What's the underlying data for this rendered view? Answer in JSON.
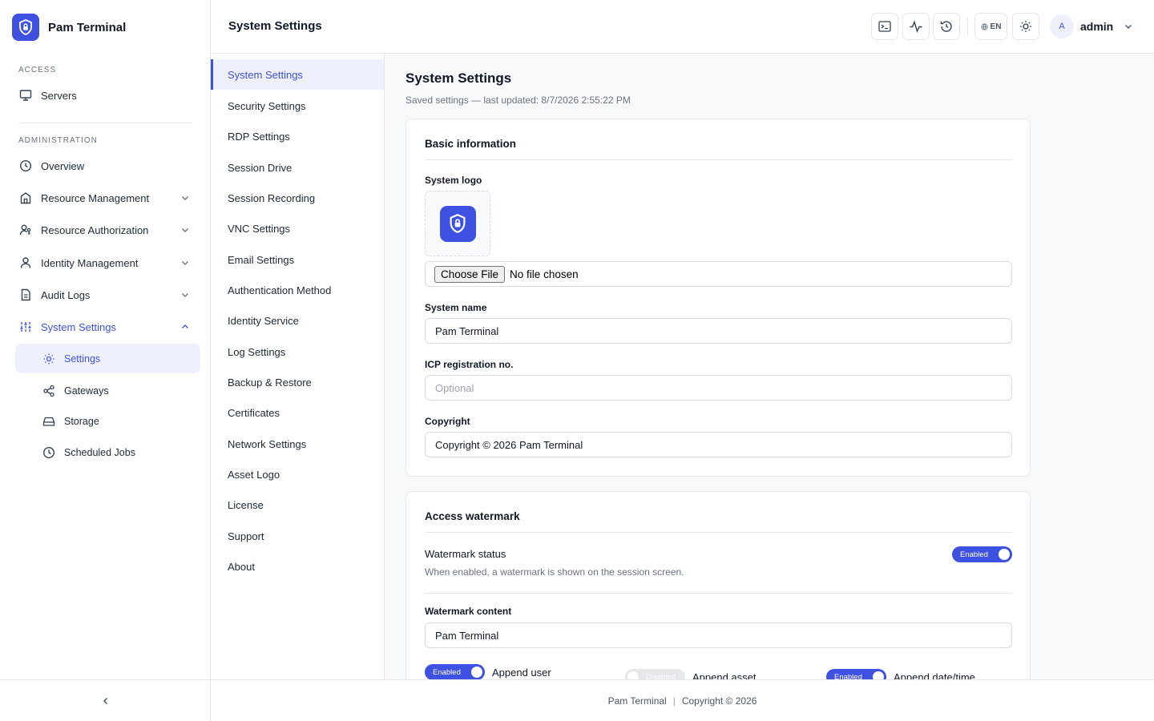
{
  "app": {
    "name": "Pam Terminal"
  },
  "sidebar": {
    "section_access": "ACCESS",
    "access_items": [
      {
        "label": "Servers",
        "icon": "monitor-icon"
      }
    ],
    "section_admin": "ADMINISTRATION",
    "admin_items": [
      {
        "label": "Overview",
        "icon": "clock-icon"
      },
      {
        "label": "Resource Management",
        "icon": "building-icon"
      },
      {
        "label": "Resource Authorization",
        "icon": "user-key-icon"
      },
      {
        "label": "Identity Management",
        "icon": "user-icon"
      },
      {
        "label": "Audit Logs",
        "icon": "document-icon"
      },
      {
        "label": "System Settings",
        "icon": "sliders-icon"
      }
    ],
    "system_sub_items": [
      {
        "label": "Settings",
        "icon": "sun-gear-icon"
      },
      {
        "label": "Gateways",
        "icon": "share-icon"
      },
      {
        "label": "Storage",
        "icon": "hard-drive-icon"
      },
      {
        "label": "Scheduled Jobs",
        "icon": "clock-icon"
      }
    ]
  },
  "header": {
    "title": "System Settings",
    "language": "EN",
    "user_initial": "A",
    "username": "admin"
  },
  "subnav": {
    "items": [
      "System Settings",
      "Security Settings",
      "RDP Settings",
      "Session Drive",
      "Session Recording",
      "VNC Settings",
      "Email Settings",
      "Authentication Method",
      "Identity Service",
      "Log Settings",
      "Backup & Restore",
      "Certificates",
      "Network Settings",
      "Asset Logo",
      "License",
      "Support",
      "About"
    ]
  },
  "main": {
    "title": "System Settings",
    "subtitle": "Saved settings — last updated: 8/7/2026 2:55:22 PM",
    "basic": {
      "title": "Basic information",
      "logo_label": "System logo",
      "file_button": "Choose File",
      "file_status": "No file chosen",
      "name_label": "System name",
      "name_value": "Pam Terminal",
      "icp_label": "ICP registration no.",
      "icp_value": "",
      "icp_placeholder": "Optional",
      "copyright_label": "Copyright",
      "copyright_value": "Copyright © 2026 Pam Terminal"
    },
    "watermark": {
      "title": "Access watermark",
      "status_label": "Watermark status",
      "status_desc": "When enabled, a watermark is shown on the session screen.",
      "status_toggle": "Enabled",
      "content_label": "Watermark content",
      "content_value": "Pam Terminal",
      "append_user_toggle": "Enabled",
      "append_user_label": "Append user",
      "append_asset_toggle": "Disabled",
      "append_asset_label": "Append asset",
      "append_datetime_toggle": "Enabled",
      "append_datetime_label": "Append date/time"
    }
  },
  "footer": {
    "name": "Pam Terminal",
    "separator": "|",
    "copyright": "Copyright © 2026"
  },
  "colors": {
    "accent": "#3f51e0",
    "accent_soft": "#eef0fd",
    "border": "#e5e7eb"
  }
}
